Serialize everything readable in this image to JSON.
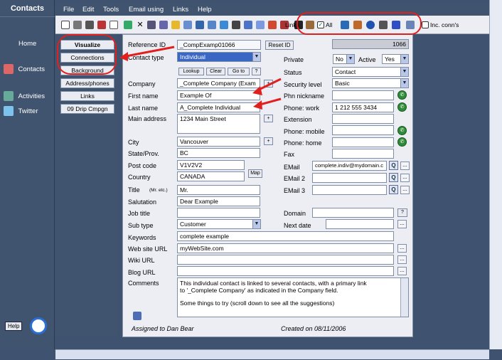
{
  "app": {
    "title": "Contacts"
  },
  "nav": {
    "items": [
      {
        "label": "Home"
      },
      {
        "label": "Contacts"
      },
      {
        "label": "Activities"
      },
      {
        "label": "Twitter"
      }
    ],
    "help_label": "Help"
  },
  "menu": [
    "File",
    "Edit",
    "Tools",
    "Email using",
    "Links",
    "Help"
  ],
  "toolbar": {
    "links_label": "Links",
    "all_label": "All",
    "inc_conns_label": "Inc. conn's"
  },
  "side_buttons": [
    "Visualize",
    "Connections",
    "Background",
    "Address/phones",
    "Links",
    "09 Drip Cmpgn"
  ],
  "form": {
    "reference_id": {
      "label": "Reference ID",
      "value": "_CompExamp01066"
    },
    "reset_id_label": "Reset ID",
    "record_no": "1066",
    "contact_type": {
      "label": "Contact type",
      "value": "Individual"
    },
    "lookup_buttons": [
      "Lookup",
      "Clear",
      "Go to",
      "?"
    ],
    "private": {
      "label": "Private",
      "value": "No"
    },
    "active": {
      "label": "Active",
      "value": "Yes"
    },
    "status": {
      "label": "Status",
      "value": "Contact"
    },
    "company": {
      "label": "Company",
      "value": "_Complete Company (Exam"
    },
    "security_level": {
      "label": "Security level",
      "value": "Basic"
    },
    "first_name": {
      "label": "First name",
      "value": "Example Of"
    },
    "phn_nickname": {
      "label": "Phn nickname",
      "value": ""
    },
    "last_name": {
      "label": "Last name",
      "value": "A_Complete Individual"
    },
    "phone_work": {
      "label": "Phone: work",
      "value": "1 212 555 3434"
    },
    "main_address": {
      "label": "Main address",
      "value": "1234 Main Street"
    },
    "extension": {
      "label": "Extension",
      "value": ""
    },
    "phone_mobile": {
      "label": "Phone: mobile",
      "value": ""
    },
    "phone_home": {
      "label": "Phone: home",
      "value": ""
    },
    "city": {
      "label": "City",
      "value": "Vancouver"
    },
    "fax": {
      "label": "Fax",
      "value": ""
    },
    "state": {
      "label": "State/Prov.",
      "value": "BC"
    },
    "post_code": {
      "label": "Post code",
      "value": "V1V2V2"
    },
    "email": {
      "label": "EMail",
      "value": "complete.indiv@mydomain.c"
    },
    "country": {
      "label": "Country",
      "value": "CANADA"
    },
    "map_label": "Map",
    "email2": {
      "label": "EMail 2",
      "value": ""
    },
    "title": {
      "label": "Title",
      "hint": "(Mr. etc.)",
      "value": "Mr."
    },
    "email3": {
      "label": "EMail 3",
      "value": ""
    },
    "salutation": {
      "label": "Salutation",
      "value": "Dear Example"
    },
    "job_title": {
      "label": "Job title",
      "value": ""
    },
    "domain": {
      "label": "Domain",
      "value": ""
    },
    "sub_type": {
      "label": "Sub type",
      "value": "Customer"
    },
    "next_date": {
      "label": "Next date",
      "value": ""
    },
    "keywords": {
      "label": "Keywords",
      "value": "complete example"
    },
    "website": {
      "label": "Web site URL",
      "value": "myWebSite.com"
    },
    "wiki": {
      "label": "Wiki URL",
      "value": ""
    },
    "blog": {
      "label": "Blog URL",
      "value": ""
    },
    "comments": {
      "label": "Comments",
      "line1": "This individual contact is linked to several contacts, with a primary link",
      "line2": "to '_Complete Company' as indicated in the Company field.",
      "line3": "Some things to try (scroll down to see all the suggestions)"
    },
    "assigned_to": "Assigned to Dan Bear",
    "created_on": "Created on 08/11/2006"
  },
  "colors": {
    "nav_bg": "#41546f",
    "form_bg": "#eceef4",
    "annotation_red": "#e0201e",
    "phone_green": "#2f8a3a"
  }
}
